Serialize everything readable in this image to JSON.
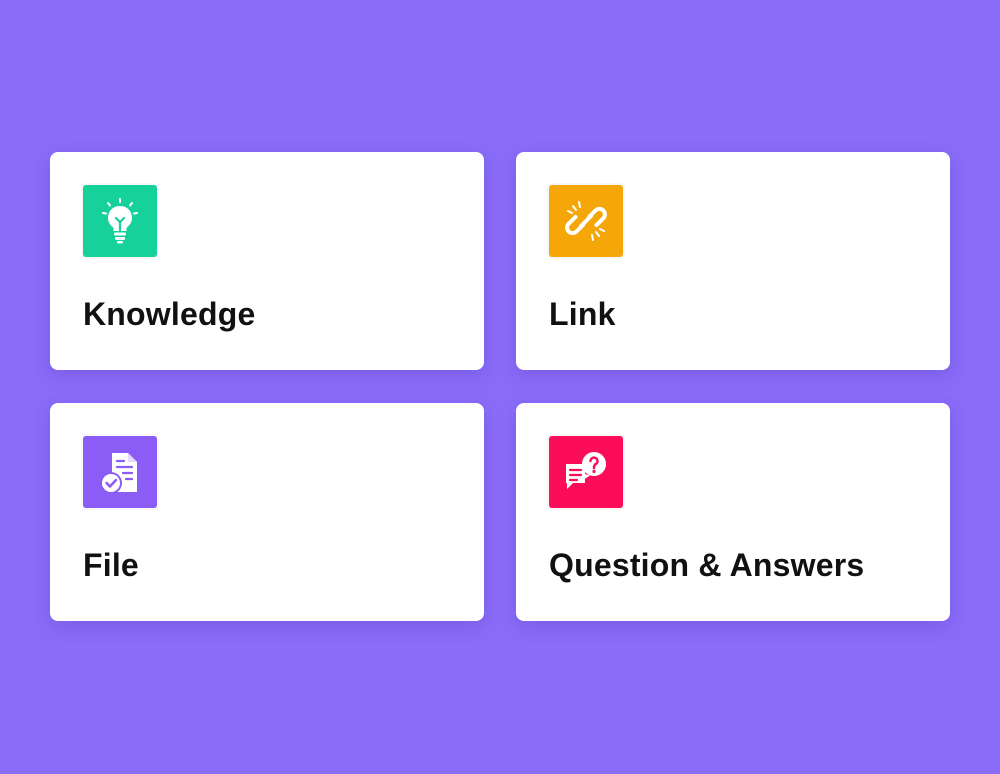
{
  "colors": {
    "background": "#896cf8",
    "card": "#ffffff",
    "text": "#111111"
  },
  "cards": [
    {
      "label": "Knowledge",
      "icon": "lightbulb-icon",
      "color": "#17d19a"
    },
    {
      "label": "Link",
      "icon": "chain-link-icon",
      "color": "#f5a70a"
    },
    {
      "label": "File",
      "icon": "document-check-icon",
      "color": "#8b5cf6"
    },
    {
      "label": "Question & Answers",
      "icon": "question-chat-icon",
      "color": "#fb0d5a"
    }
  ]
}
